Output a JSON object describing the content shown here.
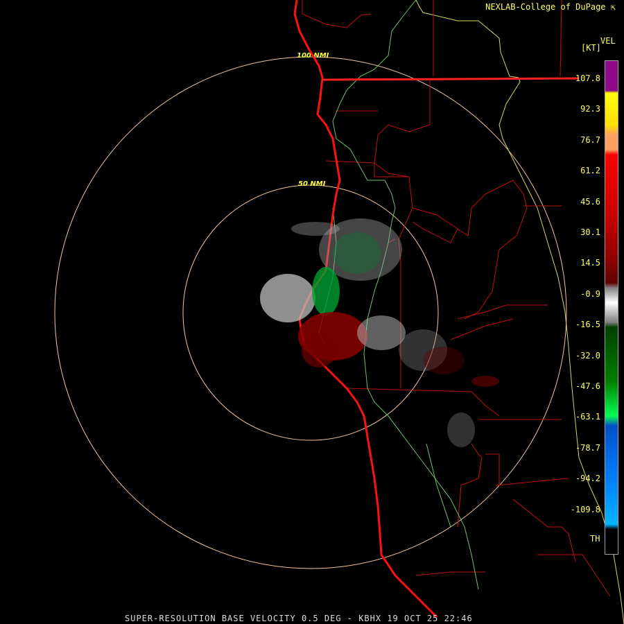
{
  "credit": "NEXLAB-College of DuPage",
  "credit_icon": "cursor-arrow-icon",
  "legend": {
    "title": "VEL",
    "unit": "[KT]",
    "ticks": [
      "107.8",
      "92.3",
      "76.7",
      "61.2",
      "45.6",
      "30.1",
      "14.5",
      "-0.9",
      "-16.5",
      "-32.0",
      "-47.6",
      "-63.1",
      "-78.7",
      "-94.2",
      "-109.8"
    ],
    "bottom_label": "TH",
    "colors": {
      "purple": "#8a0a8a",
      "yellow": "#ffff00",
      "orange": "#ffa060",
      "red": "#ff0000",
      "dark_red": "#600000",
      "gray": "#c8c8c8",
      "dark_green": "#006000",
      "green": "#00ff50",
      "blue": "#0050c8",
      "light_blue": "#00b4ff"
    }
  },
  "rings": [
    {
      "label": "50 NMI"
    },
    {
      "label": "100 NMI"
    }
  ],
  "footer": "SUPER-RESOLUTION BASE VELOCITY 0.5 DEG - KBHX 19 OCT 25 22:46"
}
